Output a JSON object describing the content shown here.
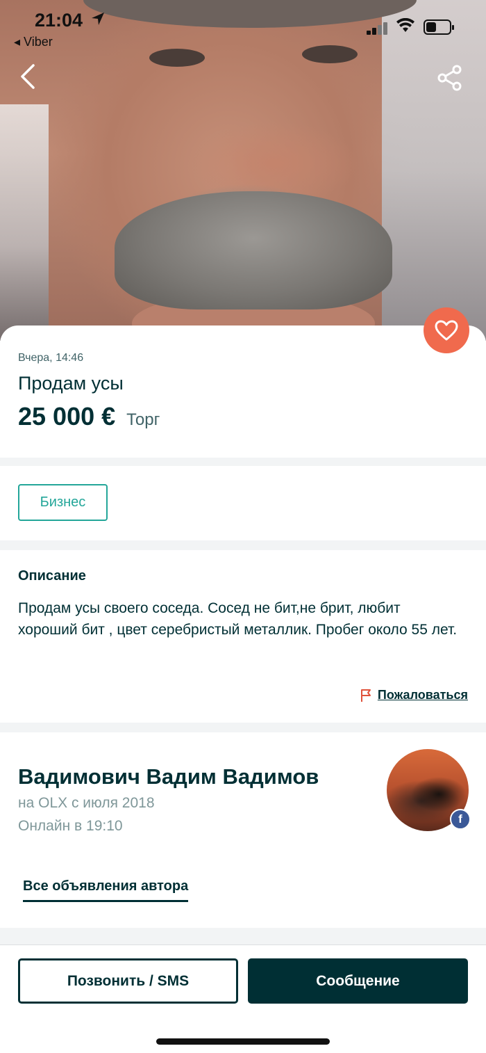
{
  "status_bar": {
    "time": "21:04",
    "back_app": "◂ Viber"
  },
  "nav": {
    "back_icon": "chevron-left-icon",
    "share_icon": "share-icon"
  },
  "listing": {
    "date": "Вчера, 14:46",
    "title": "Продам усы",
    "price": "25 000 €",
    "negotiable": "Торг",
    "category_tag": "Бизнес",
    "favorite_icon": "heart-icon"
  },
  "description": {
    "heading": "Описание",
    "text": "Продам усы своего соседа. Сосед не бит,не брит, любит хороший бит , цвет серебристый металлик. Пробег около 55 лет.",
    "report_label": "Пожаловаться"
  },
  "seller": {
    "name": "Вадимович Вадим Вадимов",
    "since": "на OLX с июля 2018",
    "online": "Онлайн в 19:10",
    "all_ads_label": "Все объявления автора",
    "facebook_badge": "f"
  },
  "actions": {
    "call_label": "Позвонить / SMS",
    "message_label": "Сообщение"
  },
  "colors": {
    "brand_dark": "#002f34",
    "accent_teal": "#23a699",
    "favorite": "#f06a4d",
    "report_flag": "#e0513a"
  }
}
